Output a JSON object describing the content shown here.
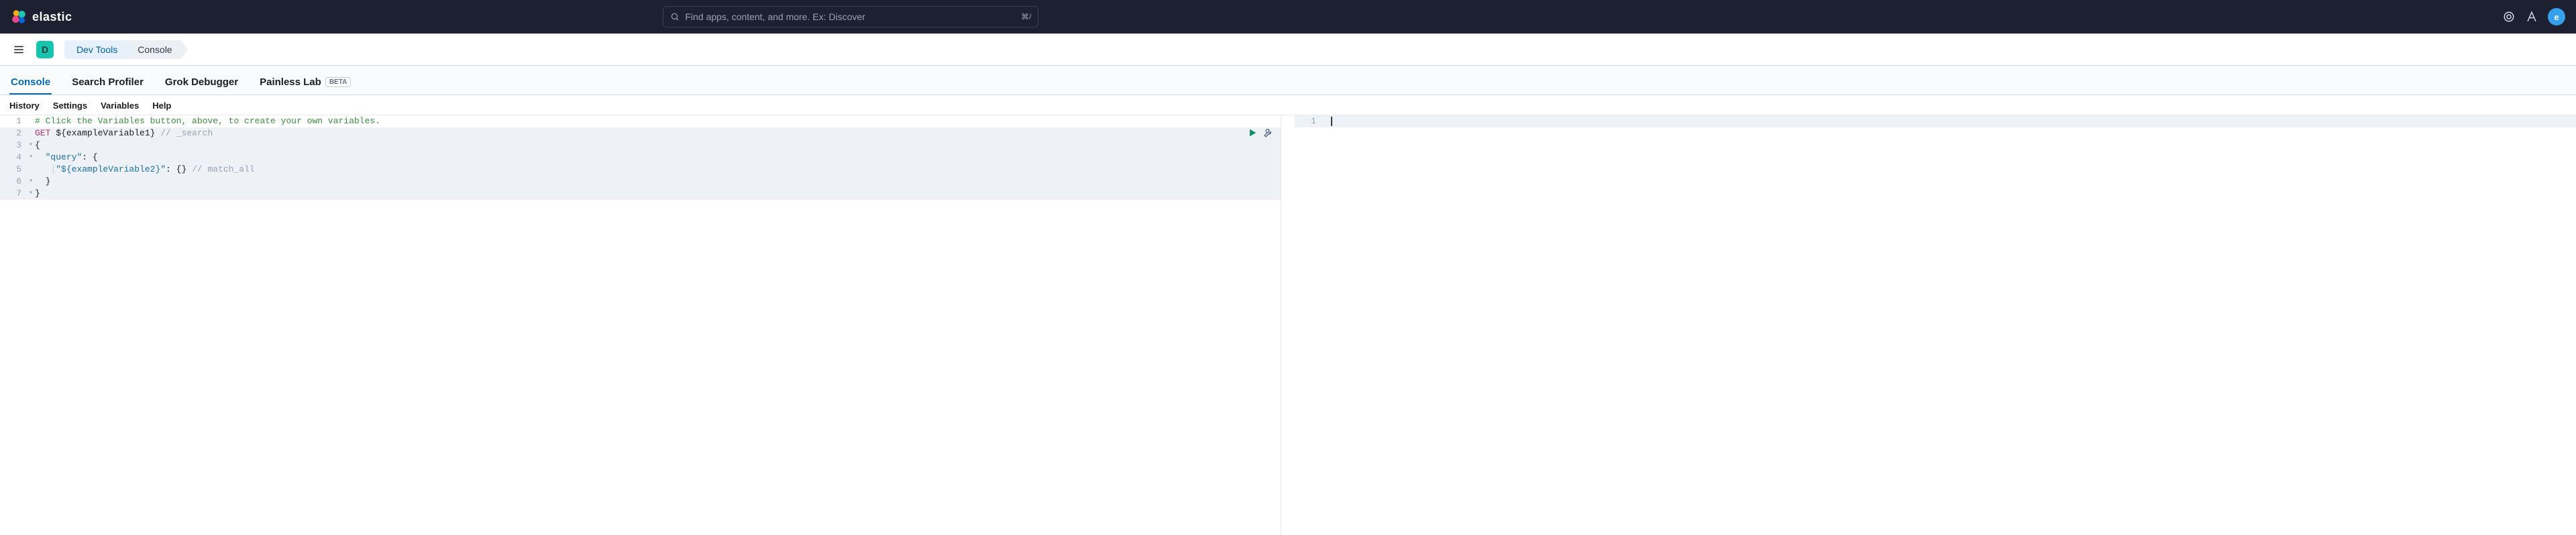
{
  "header": {
    "brand": "elastic",
    "search_placeholder": "Find apps, content, and more. Ex: Discover",
    "search_shortcut": "⌘/",
    "avatar_initial": "e"
  },
  "second_bar": {
    "chip": "D",
    "breadcrumbs": [
      "Dev Tools",
      "Console"
    ]
  },
  "main_tabs": {
    "items": [
      {
        "label": "Console",
        "active": true
      },
      {
        "label": "Search Profiler",
        "active": false
      },
      {
        "label": "Grok Debugger",
        "active": false
      },
      {
        "label": "Painless Lab",
        "active": false,
        "badge": "BETA"
      }
    ]
  },
  "sub_tabs": {
    "items": [
      "History",
      "Settings",
      "Variables",
      "Help"
    ]
  },
  "editor": {
    "left": {
      "lines": [
        {
          "n": 1,
          "fold": "",
          "segments": [
            {
              "cls": "c-comment",
              "text": "# Click the Variables button, above, to create your own variables."
            }
          ]
        },
        {
          "n": 2,
          "fold": "",
          "hl": true,
          "segments": [
            {
              "cls": "c-method",
              "text": "GET "
            },
            {
              "cls": "c-var",
              "text": "${exampleVariable1} "
            },
            {
              "cls": "c-inline-comment",
              "text": "// _search"
            }
          ]
        },
        {
          "n": 3,
          "fold": "▾",
          "hl": true,
          "segments": [
            {
              "cls": "c-punc",
              "text": "{"
            }
          ]
        },
        {
          "n": 4,
          "fold": "▾",
          "hl": true,
          "segments": [
            {
              "cls": "c-punc",
              "text": "  "
            },
            {
              "cls": "c-key",
              "text": "\"query\""
            },
            {
              "cls": "c-punc",
              "text": ": {"
            }
          ]
        },
        {
          "n": 5,
          "fold": "",
          "hl": true,
          "segments": [
            {
              "cls": "pipe",
              "text": "   │"
            },
            {
              "cls": "c-str",
              "text": "\"${exampleVariable2}\""
            },
            {
              "cls": "c-punc",
              "text": ": {} "
            },
            {
              "cls": "c-inline-comment",
              "text": "// match_all"
            }
          ]
        },
        {
          "n": 6,
          "fold": "▾",
          "hl": true,
          "segments": [
            {
              "cls": "c-punc",
              "text": "  }"
            }
          ]
        },
        {
          "n": 7,
          "fold": "▾",
          "hl": true,
          "segments": [
            {
              "cls": "c-punc",
              "text": "}"
            }
          ]
        }
      ]
    },
    "right": {
      "lines": [
        {
          "n": 1,
          "hl": true,
          "segments": [
            {
              "cls": "",
              "text": ""
            }
          ]
        }
      ]
    }
  }
}
